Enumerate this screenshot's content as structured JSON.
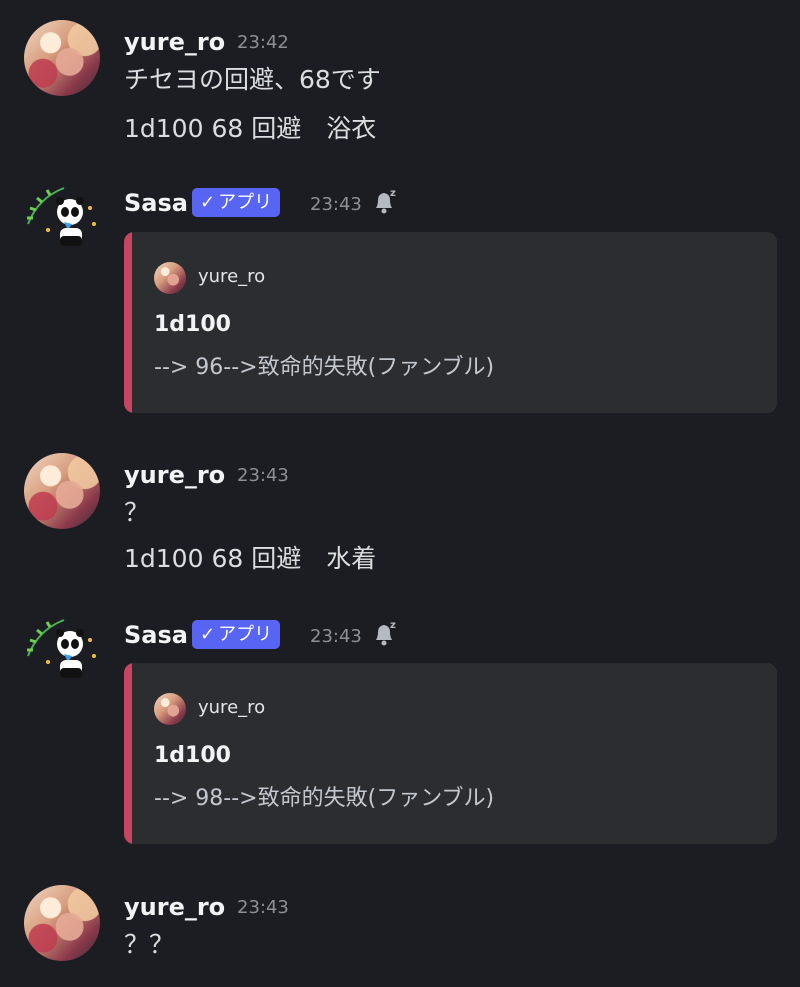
{
  "messages": [
    {
      "author": "yure_ro",
      "time": "23:42",
      "lines": [
        "チセヨの回避、68です",
        "1d100 68 回避　浴衣"
      ]
    },
    {
      "author": "Sasa",
      "badge": "アプリ",
      "time": "23:43",
      "embed": {
        "author": "yure_ro",
        "title": "1d100",
        "description": "--> 96-->致命的失敗(ファンブル)"
      }
    },
    {
      "author": "yure_ro",
      "time": "23:43",
      "lines": [
        "？",
        "1d100 68 回避　水着"
      ]
    },
    {
      "author": "Sasa",
      "badge": "アプリ",
      "time": "23:43",
      "embed": {
        "author": "yure_ro",
        "title": "1d100",
        "description": "--> 98-->致命的失敗(ファンブル)"
      }
    },
    {
      "author": "yure_ro",
      "time": "23:43",
      "lines": [
        "？？"
      ]
    }
  ],
  "icons": {
    "bot_badge_check": "checkmark-icon",
    "notification": "bell-snooze-icon",
    "bot_avatar": "panda-bamboo-avatar"
  },
  "colors": {
    "background": "#1c1d22",
    "badge": "#5865f2",
    "embed_accent": "#c9445f",
    "embed_bg": "#2b2d31"
  }
}
